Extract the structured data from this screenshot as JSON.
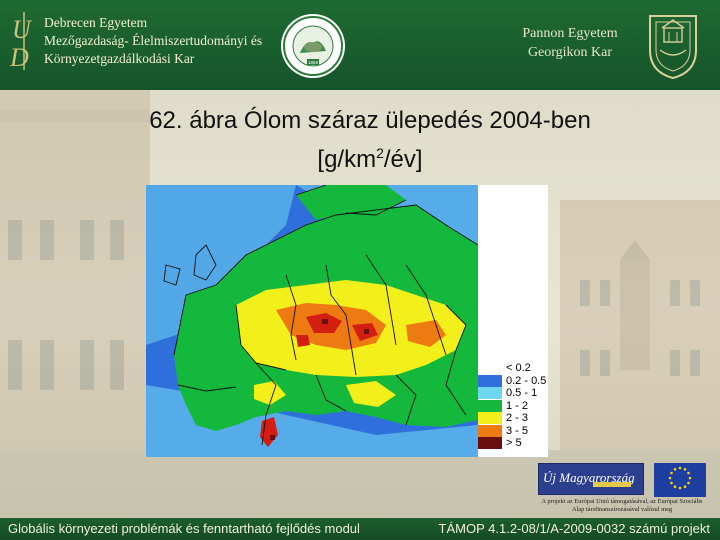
{
  "header": {
    "left_institution": [
      "Debrecen Egyetem",
      "Mezőgazdaság- Élelmiszertudományi és",
      "Környezetgazdálkodási Kar"
    ],
    "right_institution": [
      "Pannon Egyetem",
      "Georgikon Kar"
    ],
    "crest_text": "UNIVERSITAS KESZTHELYIENSIS",
    "seal_text": "1868"
  },
  "slide": {
    "title_line1": "62. ábra Ólom száraz ülepedés 2004-ben",
    "title_line2_pre": "[g/km",
    "title_line2_sup": "2",
    "title_line2_post": "/év]"
  },
  "legend": {
    "items": [
      {
        "label": "< 0.2",
        "color": "#ffffff"
      },
      {
        "label": "0.2 - 0.5",
        "color": "#2f6fdc"
      },
      {
        "label": "0.5 - 1",
        "color": "#6fd6f0"
      },
      {
        "label": "1 - 2",
        "color": "#14b83c"
      },
      {
        "label": "2 - 3",
        "color": "#f2ef1a"
      },
      {
        "label": "3 - 5",
        "color": "#ee7a12"
      },
      {
        "label": "> 5",
        "color": "#6a0f0f"
      }
    ]
  },
  "map_colors": {
    "ocean": "#2f6fdc",
    "light": "#6fd6f0",
    "green": "#14b83c",
    "yellow": "#f2ef1a",
    "orange": "#ee7a12",
    "red": "#d41e12",
    "dark": "#6a0f0f",
    "border": "#111111"
  },
  "partners": {
    "um_logo": "Új Magyarország",
    "eu_logo_stars": "EU flag",
    "eu_note": "A projekt az Európai Unió támogatásával, az Európai Szociális Alap társfinanszírozásával valósul meg"
  },
  "footer": {
    "left": "Globális környezeti problémák és fenntartható fejlődés modul",
    "right": "TÁMOP 4.1.2-08/1/A-2009-0032 számú projekt"
  }
}
